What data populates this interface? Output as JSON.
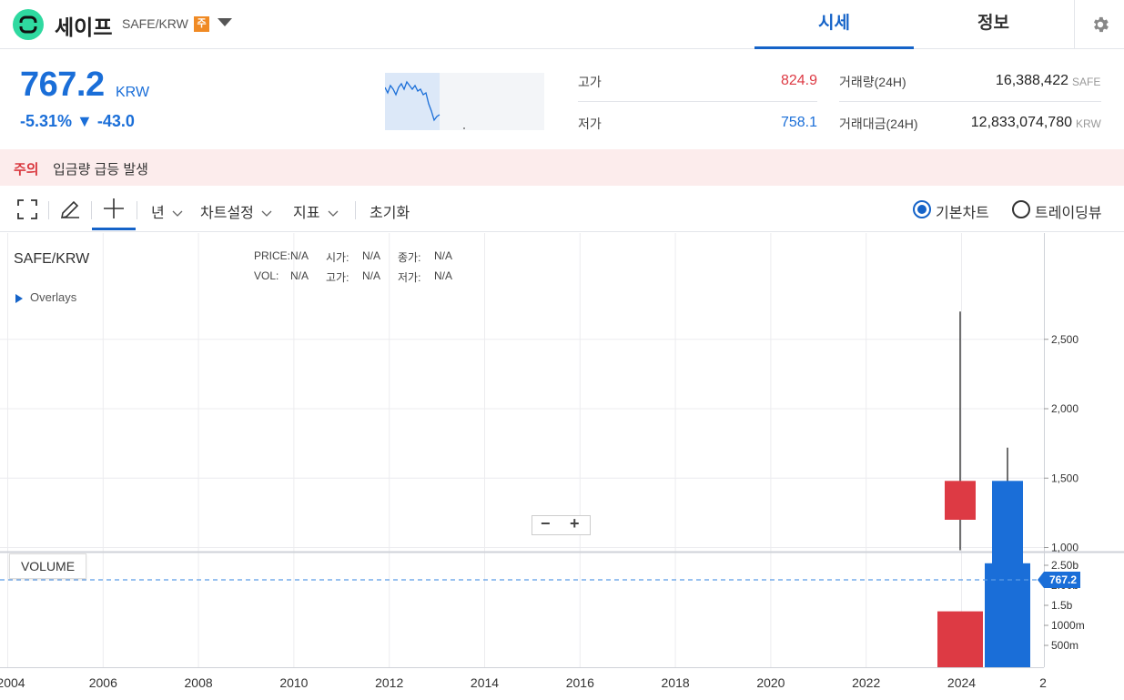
{
  "header": {
    "coin_name": "세이프",
    "pair": "SAFE/KRW",
    "badge": "주",
    "tabs": [
      {
        "label": "시세",
        "active": true
      },
      {
        "label": "정보",
        "active": false
      }
    ]
  },
  "price": {
    "value": "767.2",
    "unit": "KRW",
    "change": "-5.31% ▼ -43.0"
  },
  "stats": {
    "high_label": "고가",
    "high_value": "824.9",
    "low_label": "저가",
    "low_value": "758.1",
    "volume_label": "거래량(24H)",
    "volume_value": "16,388,422",
    "volume_unit": "SAFE",
    "amount_label": "거래대금(24H)",
    "amount_value": "12,833,074,780",
    "amount_unit": "KRW"
  },
  "alert": {
    "tag": "주의",
    "text": "입금량 급등 발생"
  },
  "toolbar": {
    "period": "년",
    "chart_settings": "차트설정",
    "indicators": "지표",
    "reset": "초기화",
    "basic_chart": "기본차트",
    "trading_view": "트레이딩뷰"
  },
  "chart": {
    "title": "SAFE/KRW",
    "overlays": "Overlays",
    "info": {
      "price_label": "PRICE:",
      "price": "N/A",
      "open_label": "시가:",
      "open": "N/A",
      "close_label": "종가:",
      "close": "N/A",
      "vol_label": "VOL:",
      "vol": "N/A",
      "high_label": "고가:",
      "high": "N/A",
      "low_label": "저가:",
      "low": "N/A"
    },
    "volume_label": "VOLUME",
    "zoom_out": "−",
    "zoom_in": "+",
    "current_price_tag": "767.2"
  },
  "colors": {
    "up": "#dd3a44",
    "down": "#1a6ed8",
    "accent": "#1563c8",
    "alert_bg": "#fcecec"
  },
  "chart_data": {
    "type": "candlestick",
    "x_ticks": [
      "2004",
      "2006",
      "2008",
      "2010",
      "2012",
      "2014",
      "2016",
      "2018",
      "2020",
      "2022",
      "2024",
      "2"
    ],
    "price_ticks": [
      "1,000",
      "1,500",
      "2,000",
      "2,500"
    ],
    "volume_ticks": [
      "500m",
      "1000m",
      "1.5b",
      "2.00b",
      "2.50b"
    ],
    "candles": [
      {
        "year": 2024,
        "open": 1200,
        "close": 1480,
        "high": 2700,
        "low": 980,
        "direction": "up"
      },
      {
        "year": 2025,
        "open": 1480,
        "close": 767.2,
        "high": 1720,
        "low": 540,
        "direction": "down"
      }
    ],
    "volumes": [
      {
        "year": 2024,
        "value": 1350000000.0,
        "direction": "up"
      },
      {
        "year": 2025,
        "value": 2550000000.0,
        "direction": "down"
      }
    ],
    "current_price": 767.2
  }
}
